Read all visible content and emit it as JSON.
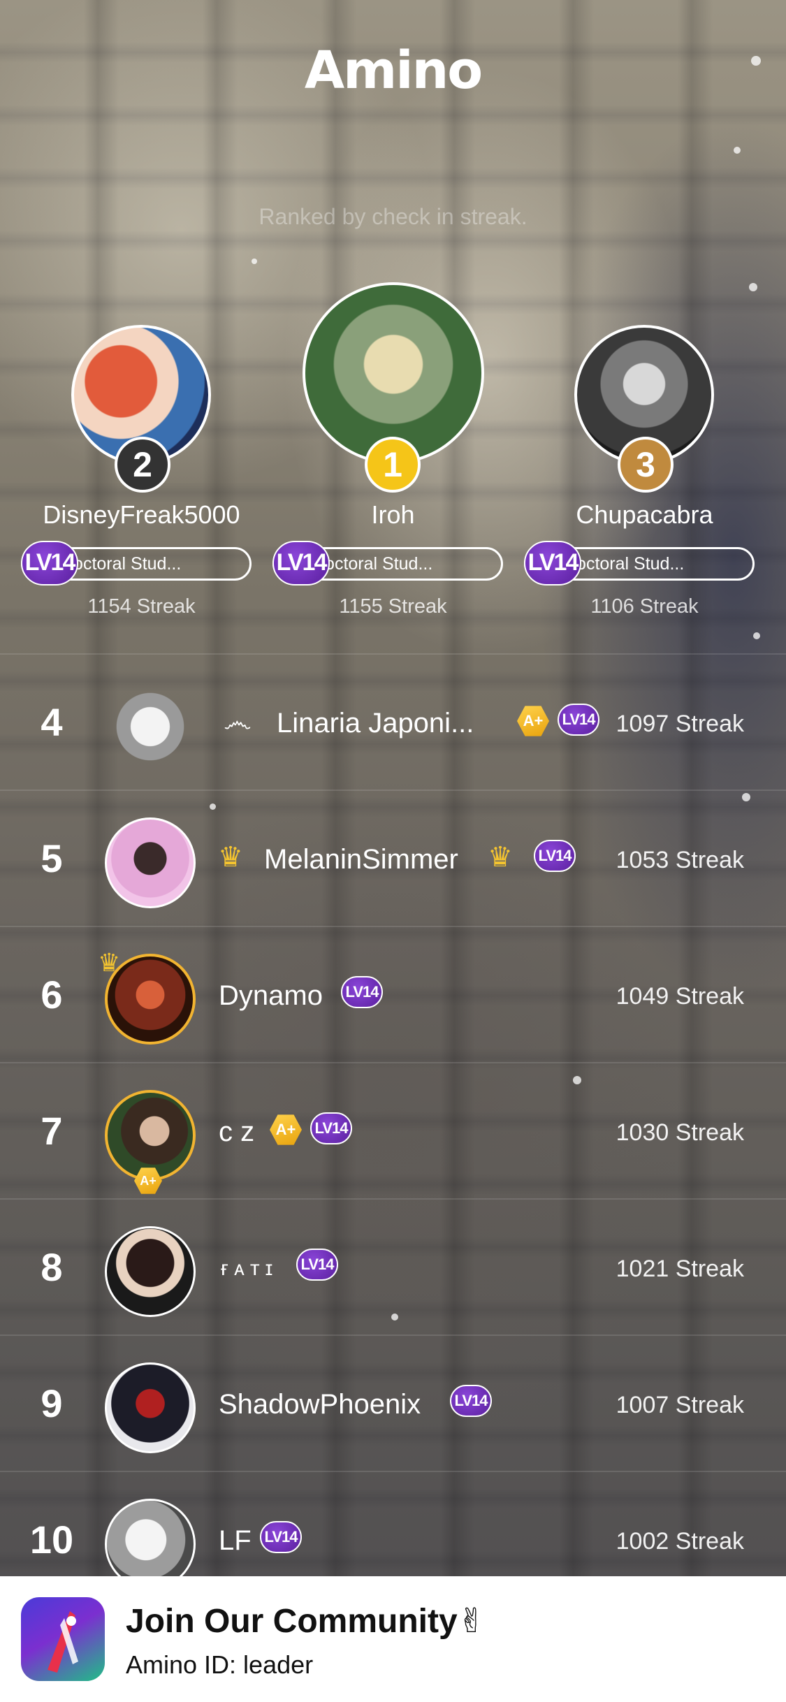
{
  "app": {
    "logo_text": "Amino"
  },
  "header": {
    "subtitle": "Ranked by check in streak."
  },
  "podium": [
    {
      "rank": "2",
      "name": "DisneyFreak5000",
      "level": "LV14",
      "title": "Doctoral Stud...",
      "streak": "1154 Streak",
      "rank_color": "#333333"
    },
    {
      "rank": "1",
      "name": "Iroh",
      "level": "LV14",
      "title": "Doctoral Stud...",
      "streak": "1155 Streak",
      "rank_color": "#f5c518"
    },
    {
      "rank": "3",
      "name": "Chupacabra",
      "level": "LV14",
      "title": "Doctoral Stud...",
      "streak": "1106 Streak",
      "rank_color": "#c08a3e"
    }
  ],
  "leaderboard": [
    {
      "rank": "4",
      "name": "Linaria Japoni...",
      "level": "LV14",
      "streak": "1097 Streak",
      "badge": "A+"
    },
    {
      "rank": "5",
      "name": "MelaninSimmer",
      "level": "LV14",
      "streak": "1053 Streak"
    },
    {
      "rank": "6",
      "name": "Dynamo",
      "level": "LV14",
      "streak": "1049 Streak"
    },
    {
      "rank": "7",
      "name": "c z",
      "level": "LV14",
      "streak": "1030 Streak",
      "badge": "A+"
    },
    {
      "rank": "8",
      "name": "ғᴀᴛɪ",
      "level": "LV14",
      "streak": "1021 Streak"
    },
    {
      "rank": "9",
      "name": "ShadowPhoenix",
      "level": "LV14",
      "streak": "1007 Streak"
    },
    {
      "rank": "10",
      "name": "LF",
      "level": "LV14",
      "streak": "1002 Streak"
    }
  ],
  "banner": {
    "title": "Join Our Community✌",
    "subtitle": "Amino ID: leader"
  },
  "colors": {
    "level_purple": "#6b2fb8",
    "gold": "#f5c518",
    "bronze": "#c08a3e"
  }
}
